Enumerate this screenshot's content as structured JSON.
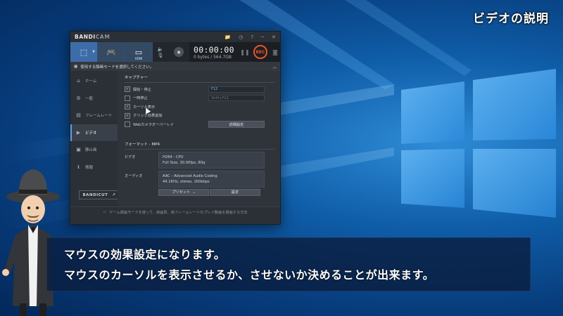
{
  "topic_title": "ビデオの説明",
  "window": {
    "brand_main": "BANDI",
    "brand_sub": "CAM",
    "controls": [
      "📁",
      "◷",
      "?",
      "─",
      "✕"
    ],
    "toolbar": {
      "modes": [
        {
          "icon": "screen-rect-icon",
          "glyph": "⬚"
        },
        {
          "icon": "gamepad-icon",
          "glyph": "🎮"
        },
        {
          "icon": "hdmi-device-icon",
          "glyph": "▭",
          "sub": "HDMI"
        }
      ],
      "timer": "00:00:00",
      "size": "0 bytes / 564.7GB",
      "rec_label": "REC"
    },
    "infobar": "使用する録画モードを選択してください。",
    "sidebar": {
      "items": [
        {
          "label": "ホーム",
          "glyph": "⌂"
        },
        {
          "label": "一般",
          "glyph": "⚙"
        },
        {
          "label": "フレームレート",
          "glyph": "▤"
        },
        {
          "label": "ビデオ",
          "glyph": "▶",
          "active": true
        },
        {
          "label": "静止画",
          "glyph": "▣"
        },
        {
          "label": "情報",
          "glyph": "ℹ"
        }
      ],
      "bandicut": "BANDICUT",
      "bandicut_arrow": "↗"
    },
    "capture": {
      "title": "キャプチャー",
      "options": [
        {
          "label": "開始・停止",
          "checked": true,
          "hotkey": "F12"
        },
        {
          "label": "一時停止",
          "checked": false,
          "hotkey": "Shift+F12"
        },
        {
          "label": "カーソル表示",
          "checked": true
        },
        {
          "label": "クリック効果追加",
          "checked": true
        },
        {
          "label": "Webカメラオーバーレイ",
          "checked": false
        }
      ],
      "advanced_button": "詳細設定"
    },
    "format": {
      "title": "フォーマット - MP4",
      "video_label": "ビデオ",
      "video_line1": "H264 - CPU",
      "video_line2": "Full Size, 30.00fps, 80q",
      "audio_label": "オーディオ",
      "audio_line1": "AAC - Advanced Audio Coding",
      "audio_line2": "44.1KHz, stereo, 160kbps",
      "preset_button": "プリセット",
      "preset_arrow": "⌄",
      "settings_button": "設定"
    },
    "footer": "ゲーム録画モードを使って、高画質、高フレームレートのプレイ動画を録画する方法"
  },
  "subtitle": {
    "line1": "マウスの効果設定になります。",
    "line2": "マウスのカーソルを表示させるか、させないか決めることが出来ます。"
  }
}
